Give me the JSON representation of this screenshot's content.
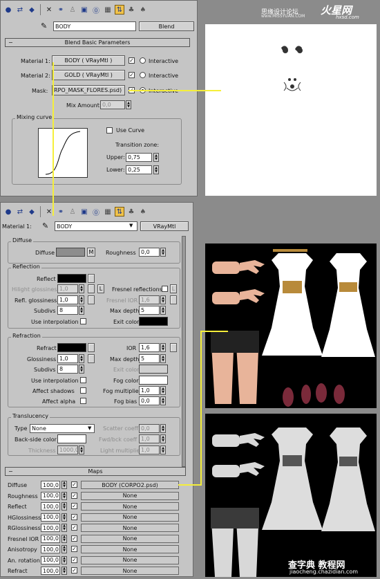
{
  "watermark": {
    "cn": "思缘设计论坛",
    "domain": "www.MISSYUAN.COM",
    "brand": "火星网",
    "brand_sub": "hxsd.com"
  },
  "footer_watermark": {
    "cn": "查字典 教程网",
    "url": "jiaocheng.chazidian.com"
  },
  "top_editor": {
    "toolbar_icons": [
      "pick-icon",
      "put-icon",
      "assign-icon",
      "reset-icon",
      "unique-icon",
      "library-icon",
      "id-icon",
      "show-map-icon",
      "show-end-icon",
      "parent-icon",
      "sibling-icon"
    ],
    "material_name": "BODY",
    "type_button": "Blend",
    "rollup_title": "Blend Basic Parameters",
    "material1_label": "Material 1:",
    "material1_value": "BODY  ( VRayMtl )",
    "material2_label": "Material 2:",
    "material2_value": "GOLD  ( VRayMtl )",
    "mask_label": "Mask:",
    "mask_value": "RPO_MASK_FLORES.psd)",
    "interactive_label": "Interactive",
    "mix_amount_label": "Mix Amount:",
    "mix_amount_value": "0,0",
    "mixing_curve_title": "Mixing curve",
    "use_curve_label": "Use Curve",
    "transition_zone_label": "Transition zone:",
    "upper_label": "Upper:",
    "upper_value": "0,75",
    "lower_label": "Lower:",
    "lower_value": "0,25"
  },
  "bottom_editor": {
    "material_label": "Material 1:",
    "material_name": "BODY",
    "type_button": "VRayMtl",
    "diffuse_group": "Diffuse",
    "diffuse_label": "Diffuse",
    "diffuse_m": "M",
    "roughness_label": "Roughness",
    "roughness_value": "0,0",
    "reflection_group": "Reflection",
    "reflect_label": "Reflect",
    "hilight_label": "Hilight glossiness",
    "hilight_value": "1,0",
    "hilight_l": "L",
    "fresnel_label": "Fresnel reflections",
    "fresnel_l": "L",
    "refl_gloss_label": "Refl. glossiness",
    "refl_gloss_value": "1,0",
    "fresnel_ior_label": "Fresnel IOR",
    "fresnel_ior_value": "1,6",
    "subdivs_label": "Subdivs",
    "subdivs_value": "8",
    "max_depth_label": "Max depth",
    "max_depth_value": "5",
    "use_interp_label": "Use interpolation",
    "exit_color_label": "Exit color",
    "refraction_group": "Refraction",
    "refract_label": "Refract",
    "ior_label": "IOR",
    "ior_value": "1,6",
    "glossiness_label": "Glossiness",
    "glossiness_value": "1,0",
    "r_max_depth_label": "Max depth",
    "r_max_depth_value": "5",
    "r_subdivs_label": "Subdivs",
    "r_subdivs_value": "8",
    "r_exit_color_label": "Exit color",
    "r_use_interp_label": "Use interpolation",
    "fog_color_label": "Fog color",
    "affect_shadows_label": "Affect shadows",
    "fog_mult_label": "Fog multiplier",
    "fog_mult_value": "1,0",
    "affect_alpha_label": "Affect alpha",
    "fog_bias_label": "Fog bias",
    "fog_bias_value": "0,0",
    "translucency_group": "Translucency",
    "type_label": "Type",
    "type_value": "None",
    "scatter_label": "Scatter coeff",
    "scatter_value": "0,0",
    "backside_label": "Back-side color",
    "fwd_bck_label": "Fwd/bck coeff",
    "fwd_bck_value": "1,0",
    "thickness_label": "Thickness",
    "thickness_value": "1000,0",
    "light_mult_label": "Light multiplier",
    "light_mult_value": "1,0",
    "maps_title": "Maps",
    "maps": [
      {
        "name": "Diffuse",
        "amount": "100,0",
        "map": "BODY (CORPO2.psd)"
      },
      {
        "name": "Roughness",
        "amount": "100,0",
        "map": "None"
      },
      {
        "name": "Reflect",
        "amount": "100,0",
        "map": "None"
      },
      {
        "name": "HGlossiness",
        "amount": "100,0",
        "map": "None"
      },
      {
        "name": "RGlossiness",
        "amount": "100,0",
        "map": "None"
      },
      {
        "name": "Fresnel IOR",
        "amount": "100,0",
        "map": "None"
      },
      {
        "name": "Anisotropy",
        "amount": "100,0",
        "map": "None"
      },
      {
        "name": "An. rotation",
        "amount": "100,0",
        "map": "None"
      },
      {
        "name": "Refract",
        "amount": "100,0",
        "map": "None"
      }
    ]
  }
}
